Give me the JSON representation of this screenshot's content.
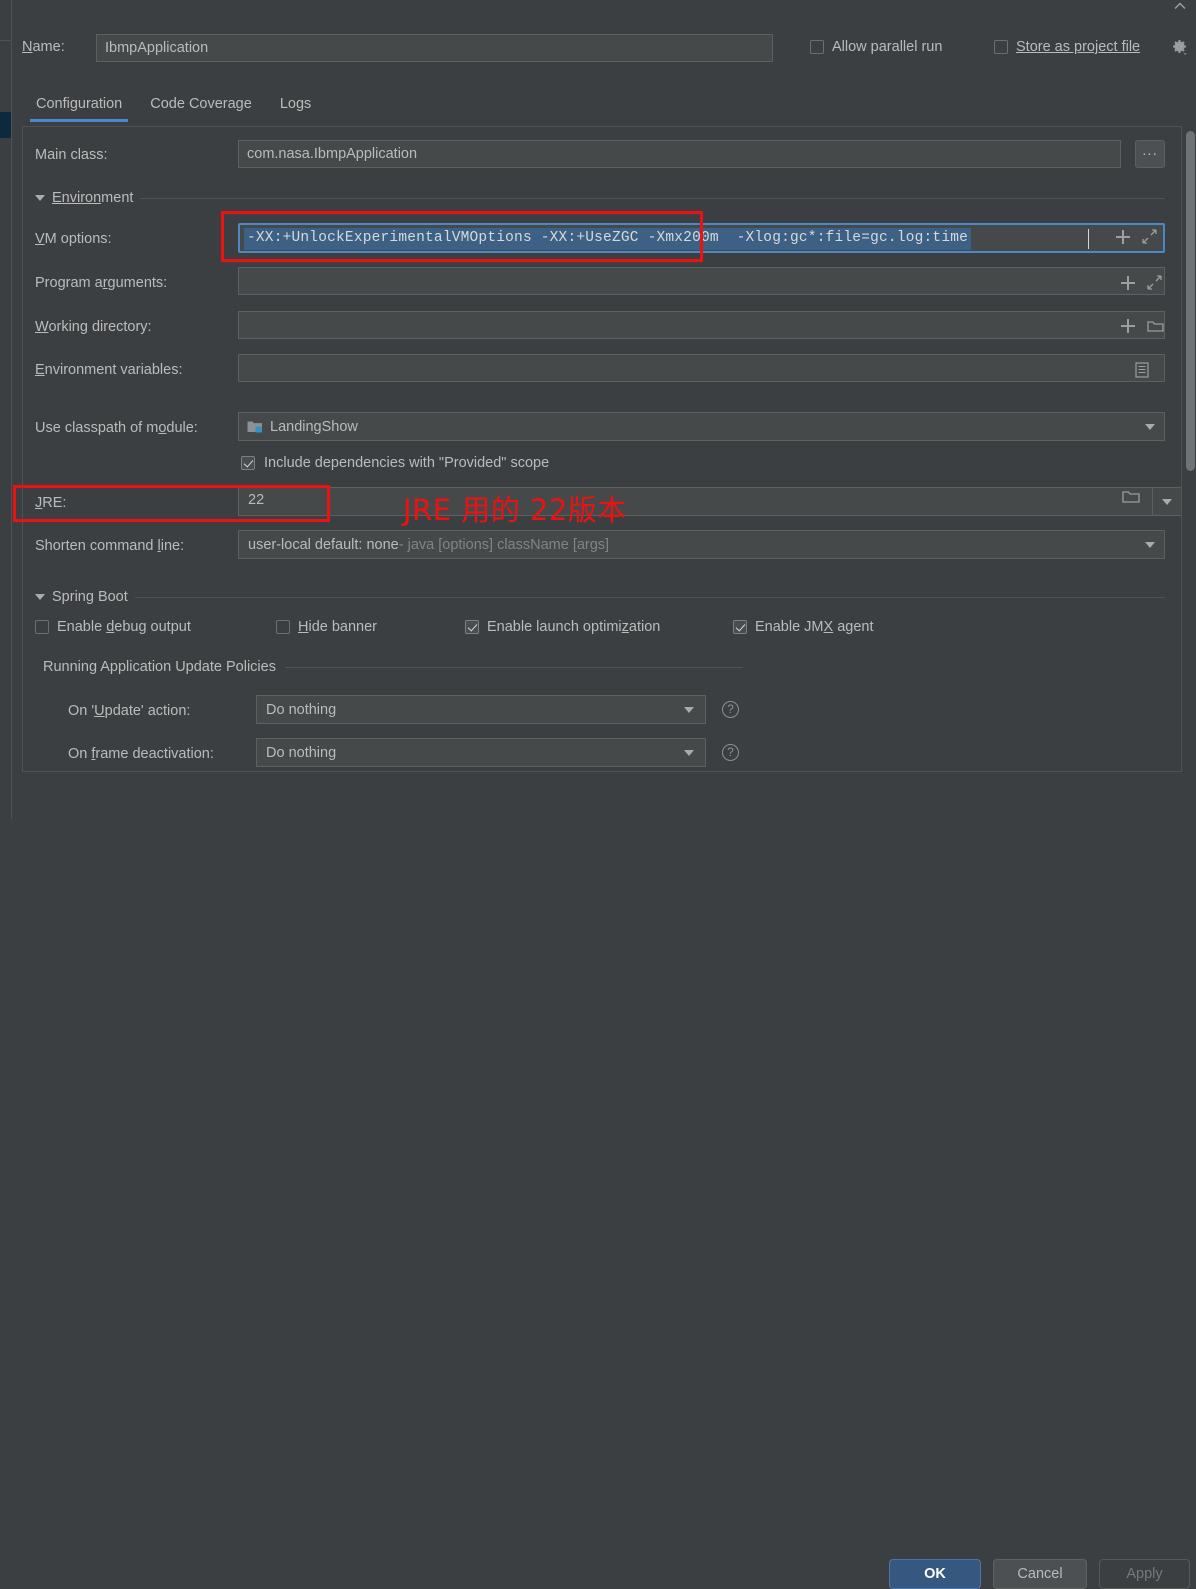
{
  "window": {
    "name_label": "Name:",
    "name_value": "IbmpApplication",
    "allow_parallel_run_label": "Allow parallel run",
    "store_as_project_file_label": "Store as project file",
    "gear_icon": "gear-icon",
    "chevron_icon": "chevron-up-icon"
  },
  "tabs": [
    {
      "label": "Configuration",
      "active": true
    },
    {
      "label": "Code Coverage",
      "active": false
    },
    {
      "label": "Logs",
      "active": false
    }
  ],
  "form": {
    "main_class": {
      "label": "Main class:",
      "value": "com.nasa.IbmpApplication",
      "browse_label": "..."
    },
    "environment_section_label": "Environment",
    "vm_options": {
      "label": "VM options:",
      "value_selected": "-XX:+UnlockExperimentalVMOptions -XX:+UseZGC ",
      "value_rest": "-Xmx200m  -Xlog:gc*:file=gc.log:time",
      "icon_add": "plus-icon",
      "icon_expand": "expand-icon"
    },
    "program_arguments": {
      "label": "Program arguments:",
      "value": "",
      "icon_add": "plus-icon",
      "icon_expand": "expand-icon"
    },
    "working_directory": {
      "label": "Working directory:",
      "value": "",
      "icon_add": "plus-icon",
      "icon_folder": "folder-icon"
    },
    "environment_variables": {
      "label": "Environment variables:",
      "value": "",
      "icon_list": "list-icon"
    },
    "classpath_module": {
      "label": "Use classpath of module:",
      "value": "LandingShow",
      "icon_module": "module-icon"
    },
    "include_provided": {
      "label": "Include dependencies with \"Provided\" scope",
      "checked": true
    },
    "jre": {
      "label": "JRE:",
      "value": "22",
      "icon_folder": "folder-icon"
    },
    "shorten_command_line": {
      "label": "Shorten command line:",
      "value": "user-local default: none",
      "value_hint": " - java [options] className [args]"
    }
  },
  "spring_boot": {
    "section_label": "Spring Boot",
    "checkboxes": [
      {
        "label": "Enable debug output",
        "checked": false
      },
      {
        "label": "Hide banner",
        "checked": false
      },
      {
        "label": "Enable launch optimization",
        "checked": true
      },
      {
        "label": "Enable JMX agent",
        "checked": true
      }
    ],
    "update_policies": {
      "section_label": "Running Application Update Policies",
      "on_update": {
        "label": "On 'Update' action:",
        "value": "Do nothing",
        "help": "?"
      },
      "on_frame_deactivation": {
        "label": "On frame deactivation:",
        "value": "Do nothing",
        "help": "?"
      }
    }
  },
  "buttons": {
    "ok": "OK",
    "cancel": "Cancel",
    "apply": "Apply"
  },
  "annotations": {
    "note_text": "JRE 用的 22版本",
    "color": "#ee1111"
  }
}
